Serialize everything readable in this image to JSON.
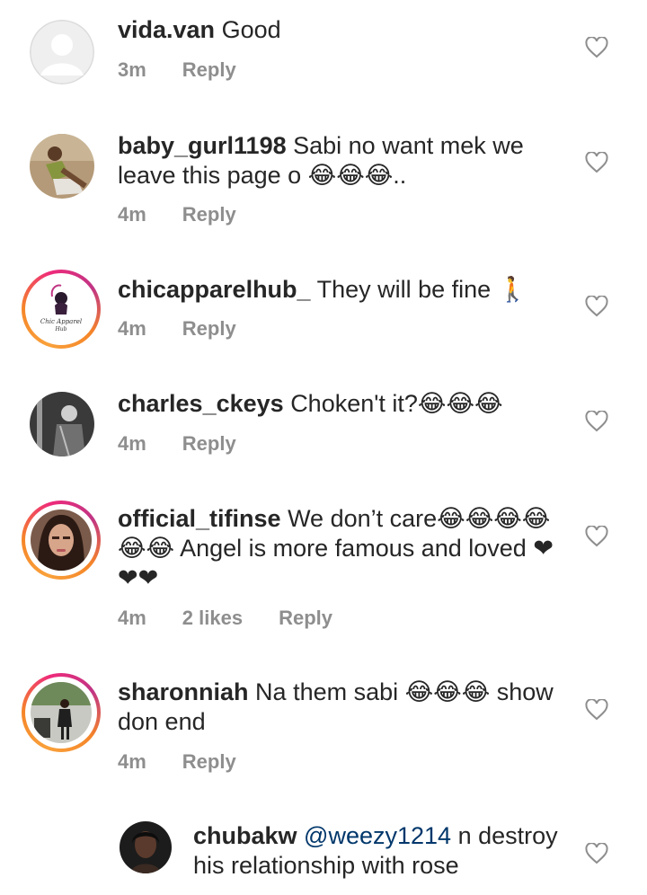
{
  "comments": [
    {
      "username": "vida.van",
      "text": "Good",
      "time": "3m",
      "likes": "",
      "reply": "Reply",
      "avatar": "default-avatar-icon"
    },
    {
      "username": "baby_gurl1198",
      "text": "Sabi no want mek we leave this page o 😂😂😂..",
      "time": "4m",
      "likes": "",
      "reply": "Reply",
      "avatar": "user-photo"
    },
    {
      "username": "chicapparelhub_",
      "text": "They will be fine 🚶",
      "time": "4m",
      "likes": "",
      "reply": "Reply",
      "avatar": "brand-logo",
      "avatar_text": "Chic Apparel Hub"
    },
    {
      "username": "charles_ckeys",
      "text": "Choken't it?😂😂😂",
      "time": "4m",
      "likes": "",
      "reply": "Reply",
      "avatar": "user-photo"
    },
    {
      "username": "official_tifinse",
      "text": "We don’t care😂😂😂😂😂😂 Angel is more famous and loved ❤❤❤",
      "time": "4m",
      "likes": "2 likes",
      "reply": "Reply",
      "avatar": "user-photo"
    },
    {
      "username": "sharonniah",
      "text": "Na them sabi 😂😂😂 show don end",
      "time": "4m",
      "likes": "",
      "reply": "Reply",
      "avatar": "user-photo"
    },
    {
      "username": "chubakw",
      "text": "@weezy1214 n destroy his relationship with rose",
      "mention": "@weezy1214",
      "rest": " n destroy his relationship with rose",
      "avatar": "user-photo"
    }
  ],
  "colors": {
    "text": "#262626",
    "meta": "#8e8e8e",
    "mention": "#00376b",
    "story_ring": "#ee2a7b"
  },
  "icons": {
    "like": "heart-outline-icon",
    "laugh": "face-with-tears-of-joy-emoji",
    "heart_emoji": "red-heart-emoji",
    "walk": "person-walking-emoji"
  }
}
